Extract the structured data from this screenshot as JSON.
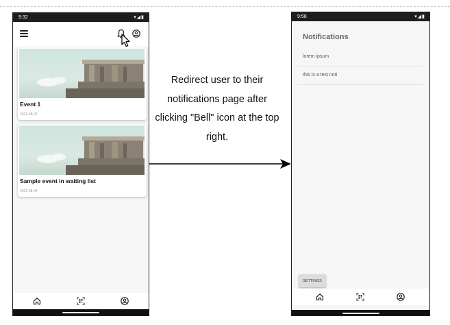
{
  "left_screen": {
    "status_time": "9:32",
    "status_icons": "▾◢▮",
    "cards": [
      {
        "title": "Event 1",
        "date": "2023-08-01"
      },
      {
        "title": "Sample event in waiting list",
        "date": "2023-08-04"
      }
    ],
    "nav_icons": [
      "home-icon",
      "qr-scan-icon",
      "profile-icon"
    ]
  },
  "caption": "Redirect user to their notifications page after clicking \"Bell\" icon at the top right.",
  "right_screen": {
    "status_time": "9:58",
    "status_icons": "▾◢▮",
    "title": "Notifications",
    "notifications": [
      {
        "text": "lorem ipsum"
      },
      {
        "text": "this is a test noti"
      }
    ],
    "settings_label": "SETTINGS",
    "nav_icons": [
      "home-icon",
      "qr-scan-icon",
      "profile-icon"
    ]
  },
  "colors": {
    "phone_background": "#f6f6f6",
    "status_bar": "#1e1e1e",
    "arrow": "#000000",
    "settings_button": "#dcdcdc"
  }
}
